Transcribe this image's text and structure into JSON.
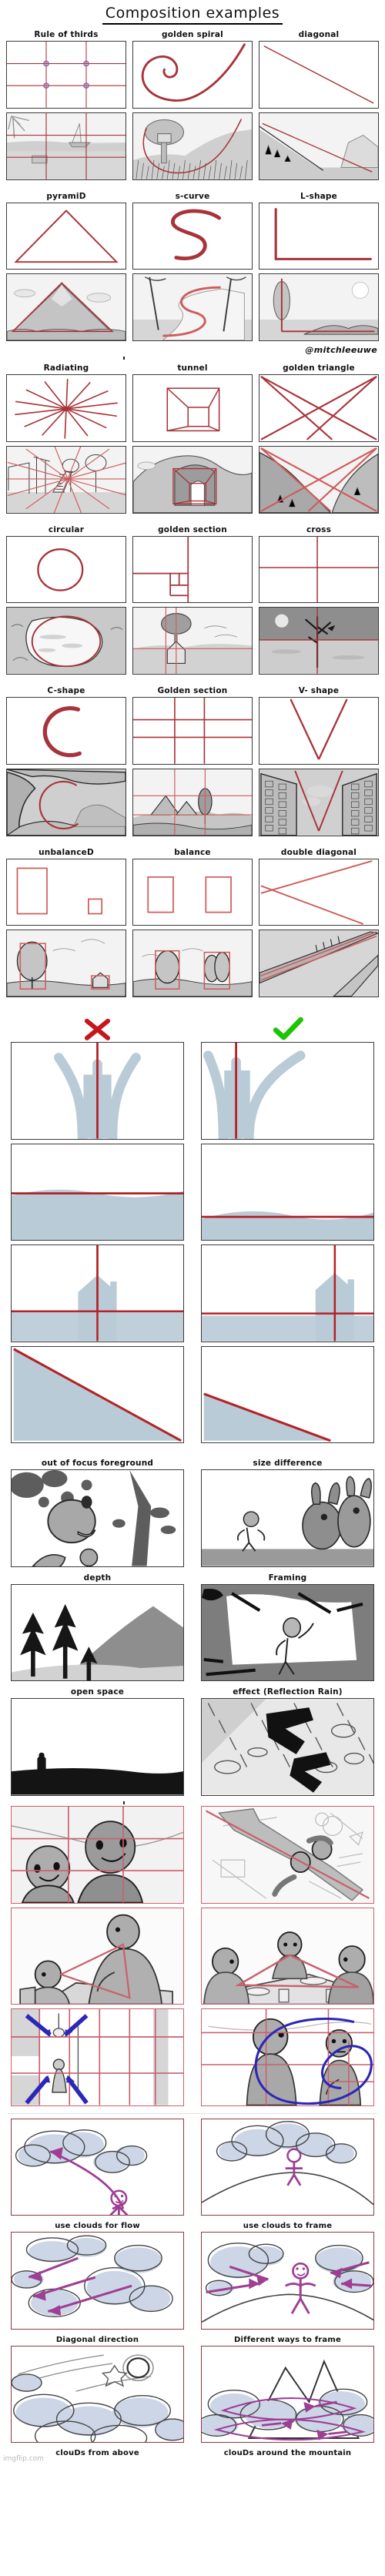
{
  "title": "Composition examples",
  "watermark": {
    "handle": "@mitchleeuwe",
    "site": "imgflip.com"
  },
  "sections": [
    {
      "id": "row1",
      "layout": "grid3",
      "captions_position": "top",
      "captions": [
        "Rule of thirds",
        "golden spiral",
        "diagonal"
      ],
      "diagram_kinds": [
        "rule-of-thirds",
        "golden-spiral",
        "diagonal"
      ],
      "example_kinds": [
        "beach-thirds",
        "tree-spiral",
        "mountain-diagonal"
      ]
    },
    {
      "id": "row2",
      "layout": "grid3",
      "captions_position": "top",
      "captions": [
        "pyramiD",
        "s-curve",
        "L-shape"
      ],
      "diagram_kinds": [
        "pyramid",
        "s-curve",
        "l-shape"
      ],
      "example_kinds": [
        "mountain-pyramid",
        "path-scurve",
        "tree-lshape"
      ]
    },
    {
      "id": "row3",
      "layout": "grid3",
      "captions_position": "top",
      "captions": [
        "Radiating",
        "tunnel",
        "golden triangle"
      ],
      "diagram_kinds": [
        "radiating",
        "tunnel",
        "golden-triangle"
      ],
      "example_kinds": [
        "rail-radiating",
        "cave-tunnel",
        "cliff-goldentriangle"
      ]
    },
    {
      "id": "row4",
      "layout": "grid3",
      "captions_position": "top",
      "captions": [
        "circular",
        "golden section",
        "cross"
      ],
      "diagram_kinds": [
        "circle",
        "golden-section-small",
        "cross"
      ],
      "example_kinds": [
        "lake-circle",
        "house-goldensection",
        "tree-cross"
      ]
    },
    {
      "id": "row5",
      "layout": "grid3",
      "captions_position": "top",
      "captions": [
        "C-shape",
        "Golden section",
        "V- shape"
      ],
      "diagram_kinds": [
        "c-shape",
        "golden-section-grid",
        "v-shape"
      ],
      "example_kinds": [
        "cave-cshape",
        "mountains-grid",
        "city-vshape"
      ]
    },
    {
      "id": "row6",
      "layout": "grid3",
      "captions_position": "top",
      "captions": [
        "unbalanceD",
        "balance",
        "double diagonal"
      ],
      "diagram_kinds": [
        "unbalanced",
        "balanced",
        "double-diagonal"
      ],
      "example_kinds": [
        "tree-house-unbalanced",
        "two-trees-balanced",
        "roads-doublediagonal"
      ]
    }
  ],
  "compare": {
    "bad_mark": "cross-mark",
    "good_mark": "check-mark",
    "bad_color": "#c4161c",
    "good_color": "#1fc400",
    "rows": [
      {
        "bad": "tree-centered",
        "good": "tree-offset"
      },
      {
        "bad": "horizon-centered",
        "good": "horizon-low"
      },
      {
        "bad": "house-centered",
        "good": "house-right"
      },
      {
        "bad": "diagonal-half",
        "good": "diagonal-shallow"
      }
    ]
  },
  "tips": {
    "layout": "grid2",
    "items": [
      {
        "caption": "out of focus foreground",
        "kind": "bokeh-foreground"
      },
      {
        "caption": "size difference",
        "kind": "size-difference"
      },
      {
        "caption": "depth",
        "kind": "depth-layers"
      },
      {
        "caption": "Framing",
        "kind": "framing-branches"
      },
      {
        "caption": "open space",
        "kind": "open-space"
      },
      {
        "caption": "effect (Reflection Rain)",
        "kind": "reflection-rain"
      }
    ]
  },
  "storyboard": {
    "rows": [
      [
        {
          "kind": "two-characters-thirds",
          "caption": ""
        },
        {
          "kind": "overhead-diagonal",
          "caption": ""
        }
      ],
      [
        {
          "kind": "table-triangle",
          "caption": ""
        },
        {
          "kind": "dinner-triangle",
          "caption": ""
        }
      ],
      [
        {
          "kind": "hallway-arrows",
          "caption": ""
        },
        {
          "kind": "spiral-two-figures",
          "caption": ""
        }
      ]
    ]
  },
  "clouds": {
    "rows": [
      {
        "panels": [
          {
            "kind": "cloud-flow",
            "caption": "use clouds for flow"
          },
          {
            "kind": "cloud-frame",
            "caption": "use clouds to frame"
          }
        ]
      },
      {
        "panels": [
          {
            "kind": "cloud-diagonal",
            "caption": "Diagonal direction"
          },
          {
            "kind": "cloud-ways-frame",
            "caption": "Different ways to frame"
          }
        ]
      },
      {
        "panels": [
          {
            "kind": "clouds-above",
            "caption": "clouDs from above"
          },
          {
            "kind": "clouds-mountain",
            "caption": "clouDs around the mountain"
          }
        ]
      }
    ]
  },
  "colors": {
    "red_line": "#a8333a",
    "red_line_light": "#cf5b5b",
    "panel_border": "#3b3b3b",
    "pink_border": "#c9606d",
    "pink_border_dark": "#8c3a44",
    "blue_gray": "#b9cbd6",
    "magenta": "#9e3f94",
    "violet": "#2b27b8"
  }
}
